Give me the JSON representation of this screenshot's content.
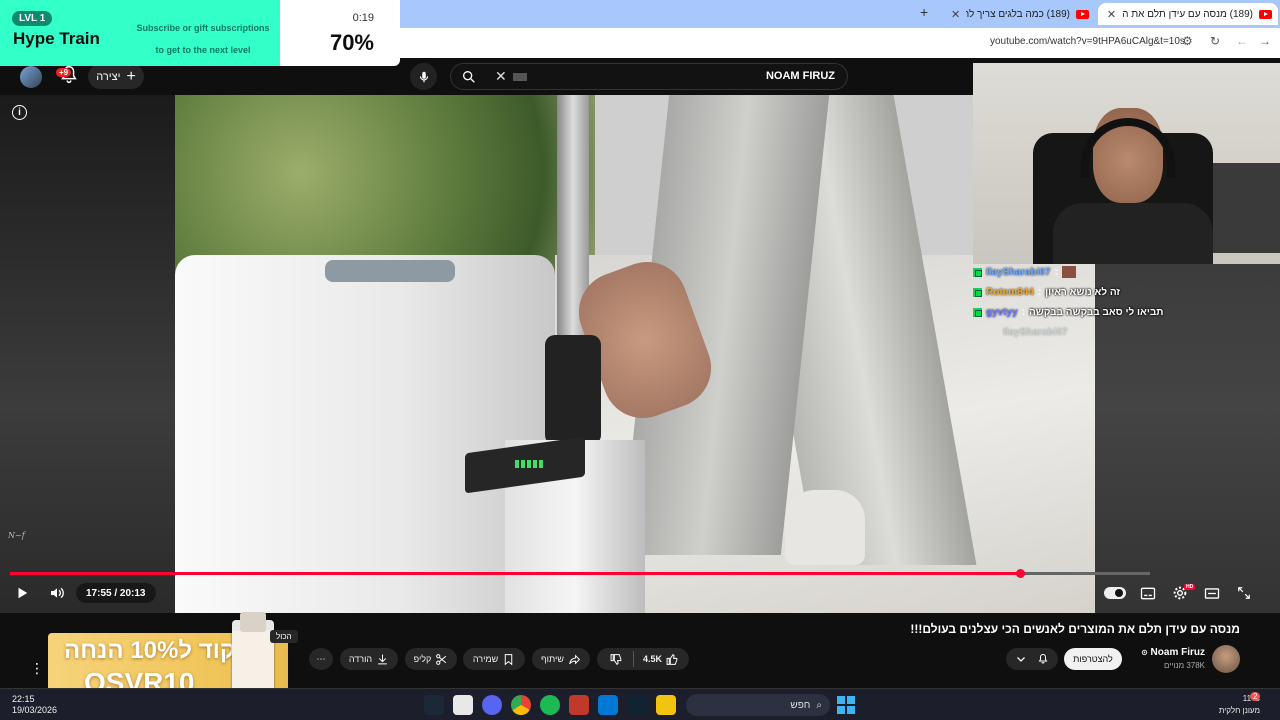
{
  "browser": {
    "tabs": [
      {
        "label": "(189) מנסה עם עידן תלם את ה",
        "active": true
      },
      {
        "label": "(189) כמה בלגים צריך להעף!",
        "active": false
      }
    ],
    "new_tab_label": "+",
    "url": "youtube.com/watch?v=9tHPA6uCAlg&t=10s"
  },
  "hype_train": {
    "level": "LVL 1",
    "title": "Hype Train",
    "subtitle_line1": "Subscribe or gift subscriptions",
    "subtitle_line2": "to get to the next level",
    "timer": "0:19",
    "percent_label": "70%",
    "percent_value": 70
  },
  "youtube_header": {
    "notifications_badge": "+9",
    "create_label": "יצירה",
    "search_query": "NOAM FIRUZ"
  },
  "chat": [
    {
      "user": "IlaySharabi07",
      "user_color": "#6ea8ff",
      "message": ""
    },
    {
      "user": "Rotem844",
      "user_color": "#e8a93a",
      "message": "זה לא נושא ראיון"
    },
    {
      "user": "gyvtyy",
      "user_color": "#6f7cff",
      "message": "תביאו לי סאב בבקשה בבקשה"
    },
    {
      "user": "IlaySharabi07",
      "user_color": "#9aa",
      "message": ""
    }
  ],
  "player": {
    "time_current": "17:55",
    "time_total": "20:13",
    "time_label": "17:55 / 20:13",
    "progress": 0.886
  },
  "video_info": {
    "title": "מנסה עם עידן תלם את המוצרים לאנשים הכי עצלנים בעולם!!!",
    "channel_name": "Noam Firuz",
    "subscribers": "378K מנויים",
    "join_label": "להצטרפות",
    "likes": "4.5K",
    "share_label": "שיתוף",
    "save_label": "שמירה",
    "clip_label": "קליפ",
    "download_label": "הורדה",
    "more_label": "⋯"
  },
  "promo": {
    "line1": "קוד ל10% הנחה",
    "line2": "OSVR10",
    "chip_label": "הכול"
  },
  "taskbar": {
    "time": "22:15",
    "date": "19/03/2026",
    "search_label": "חפש",
    "weather_temp": "11°C",
    "weather_desc": "מעונן חלקית",
    "notif_count": "2"
  }
}
